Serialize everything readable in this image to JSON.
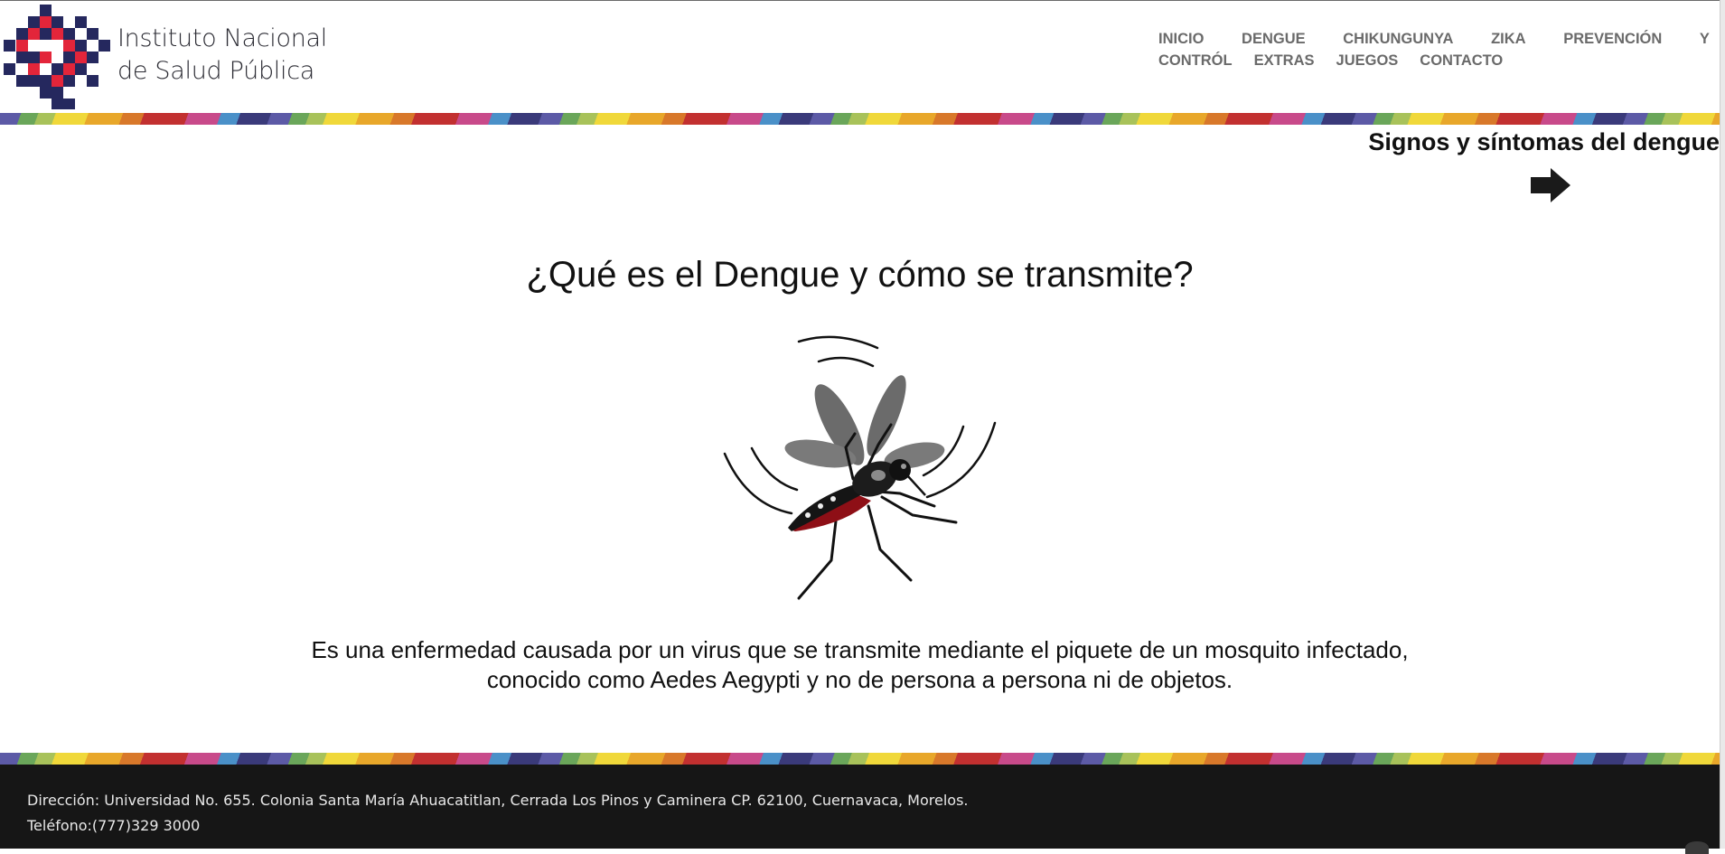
{
  "header": {
    "logo_icon": "insp-logo-icon",
    "logo_line1": "Instituto Nacional",
    "logo_line2": "de Salud Pública",
    "colors": {
      "logo_navy": "#25285e",
      "logo_red": "#e3253a"
    }
  },
  "nav": {
    "row1": [
      "INICIO",
      "DENGUE",
      "CHIKUNGUNYA",
      "ZIKA",
      "PREVENCIÓN",
      "Y"
    ],
    "row2": [
      "CONTRÓL",
      "EXTRAS",
      "JUEGOS",
      "CONTACTO"
    ]
  },
  "next": {
    "title": "Signos y síntomas del dengue",
    "icon": "arrow-right-icon"
  },
  "main": {
    "title": "¿Qué es el Dengue y cómo se transmite?",
    "illustration": "mosquito-icon",
    "description_line1": "Es una enfermedad causada por un virus que se transmite mediante el piquete de un mosquito infectado,",
    "description_line2": "conocido como Aedes Aegypti y no de persona a persona ni de objetos."
  },
  "footer": {
    "address": "Dirección: Universidad No. 655. Colonia Santa María Ahuacatitlan, Cerrada Los Pinos y Caminera CP. 62100, Cuernavaca, Morelos.",
    "phone": "Teléfono:(777)329 3000",
    "background": "#161616"
  }
}
